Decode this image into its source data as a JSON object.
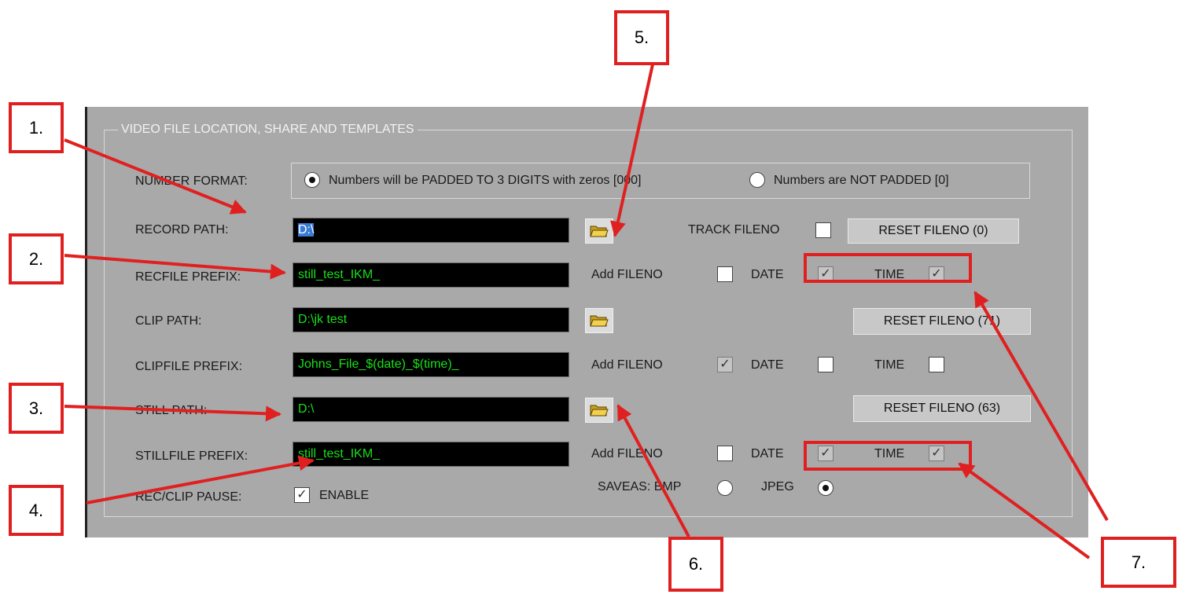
{
  "group_title": "VIDEO FILE LOCATION, SHARE AND TEMPLATES",
  "number_format": {
    "label": "NUMBER FORMAT:",
    "options": [
      {
        "label": "Numbers will be PADDED TO 3 DIGITS with zeros [000]",
        "selected": true
      },
      {
        "label": "Numbers are NOT PADDED [0]",
        "selected": false
      }
    ]
  },
  "record": {
    "path_label": "RECORD PATH:",
    "path_value": "D:\\",
    "track_label": "TRACK FILENO",
    "track_checked": false,
    "reset_label": "RESET FILENO (0)",
    "prefix_label": "RECFILE PREFIX:",
    "prefix_value": "still_test_IKM_",
    "add_label": "Add FILENO",
    "add_checked": false,
    "date_label": "DATE",
    "date_checked": true,
    "time_label": "TIME",
    "time_checked": true
  },
  "clip": {
    "path_label": "CLIP PATH:",
    "path_value": "D:\\jk test",
    "reset_label": "RESET FILENO (71)",
    "prefix_label": "CLIPFILE PREFIX:",
    "prefix_value": "Johns_File_$(date)_$(time)_",
    "add_label": "Add FILENO",
    "add_checked": true,
    "date_label": "DATE",
    "date_checked": false,
    "time_label": "TIME",
    "time_checked": false
  },
  "still": {
    "path_label": "STILL PATH:",
    "path_value": "D:\\",
    "reset_label": "RESET FILENO (63)",
    "prefix_label": "STILLFILE PREFIX:",
    "prefix_value": "still_test_IKM_",
    "add_label": "Add FILENO",
    "add_checked": false,
    "date_label": "DATE",
    "date_checked": true,
    "time_label": "TIME",
    "time_checked": true
  },
  "pause": {
    "label": "REC/CLIP PAUSE:",
    "enable_label": "ENABLE",
    "enable_checked": true
  },
  "saveas": {
    "label": "SAVEAS: BMP",
    "bmp_selected": false,
    "jpeg_label": "JPEG",
    "jpeg_selected": true
  },
  "callouts": [
    "1.",
    "2.",
    "3.",
    "4.",
    "5.",
    "6.",
    "7."
  ],
  "colors": {
    "callout": "#e02020",
    "field_text": "#18e018",
    "panel": "#a9a9a9"
  },
  "icons": {
    "folder": "open-folder-icon",
    "check": "✓"
  }
}
